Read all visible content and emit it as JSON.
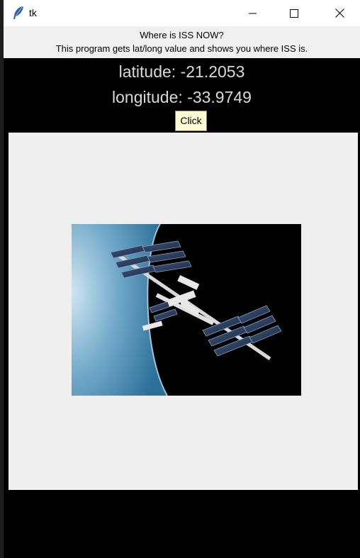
{
  "window": {
    "title": "tk",
    "icon": "feather-icon"
  },
  "titlebar_buttons": {
    "minimize_icon": "minimize-icon",
    "maximize_icon": "maximize-icon",
    "close_icon": "close-icon"
  },
  "header": {
    "line1": "Where is ISS NOW?",
    "line2": "This program gets lat/long value and shows you where ISS is."
  },
  "coords": {
    "latitude": "latitude: -21.2053",
    "longitude": "longitude: -33.9749"
  },
  "button": {
    "label": "Click"
  },
  "image": {
    "subject": "iss-image"
  },
  "colors": {
    "window_bg": "#000000",
    "coord_text": "#d9d9d9",
    "button_bg": "#fdfbd4",
    "canvas_bg": "#efefef"
  }
}
